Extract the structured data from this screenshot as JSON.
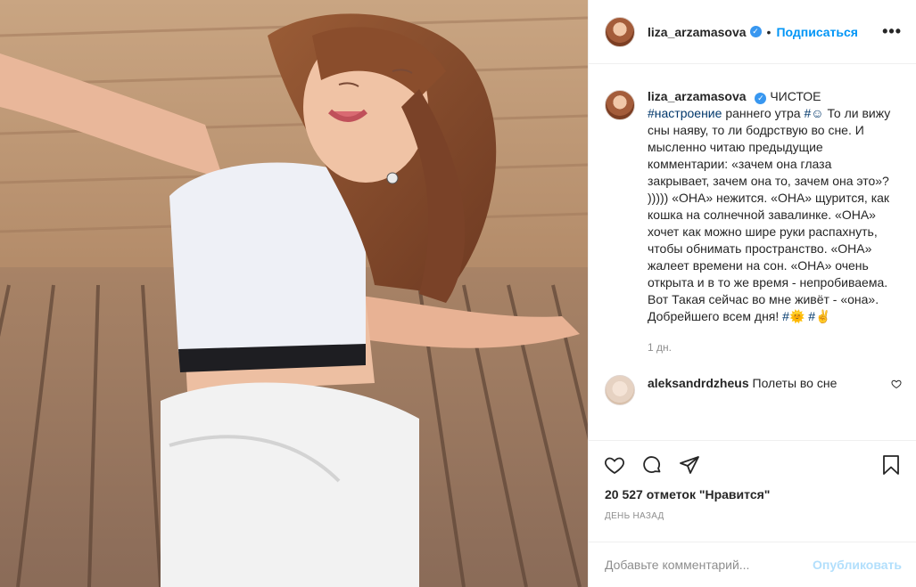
{
  "post": {
    "image_alt": "photo"
  },
  "header": {
    "username": "liza_arzamasova",
    "separator": "•",
    "follow_label": "Подписаться",
    "more_label": "•••"
  },
  "caption": {
    "username": "liza_arzamasova",
    "text_1": "ЧИСТОЕ",
    "hashtag_1": "#настроение",
    "text_2": "раннего утра",
    "hashtag_2": "#☺",
    "text_3": "То ли вижу сны наяву, то ли бодрствую во сне. И мысленно читаю предыдущие комментарии: «зачем она глаза закрывает, зачем она то, зачем она это»? ))))) «ОНА» нежится. «ОНА» щурится, как кошка на солнечной завалинке. «ОНА» хочет как можно шире руки распахнуть, чтобы обнимать пространство. «ОНА» жалеет времени на сон. «ОНА» очень открыта и в то же время - непробиваема. Вот Такая сейчас во мне живёт - «она». Добрейшего всем дня!",
    "hashtag_3": "#🌞",
    "hashtag_4": "#✌",
    "ago": "1 дн."
  },
  "reply": {
    "username": "aleksandrdzheus",
    "text": "Полеты во сне"
  },
  "actions": {
    "likes": "20 527 отметок \"Нравится\"",
    "timestamp": "ДЕНЬ НАЗАД"
  },
  "add_comment": {
    "placeholder": "Добавьте комментарий...",
    "publish_label": "Опубликовать"
  },
  "icons": [
    "heart-icon",
    "comment-icon",
    "share-icon",
    "bookmark-icon",
    "more-icon",
    "verified-icon"
  ],
  "colors": {
    "link": "#0095f6",
    "hashtag": "#00376b",
    "muted": "#8e8e8e",
    "publish_disabled": "#b2dffc"
  }
}
